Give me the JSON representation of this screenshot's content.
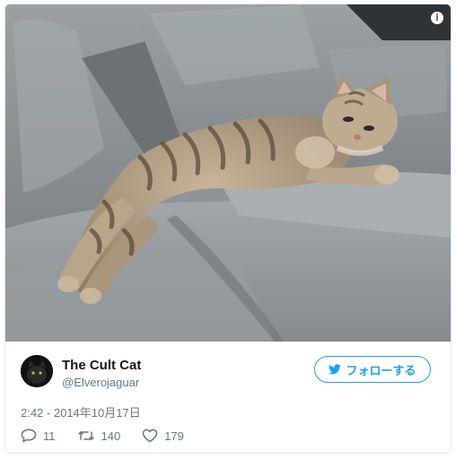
{
  "media": {
    "alt": ""
  },
  "info_icon": "i",
  "author": {
    "name": "The Cult Cat",
    "handle": "@Elverojaguar"
  },
  "follow_button": {
    "label": "フォローする",
    "icon": "twitter-bird-icon"
  },
  "timestamp": "2:42 - 2014年10月17日",
  "actions": {
    "reply_count": "11",
    "retweet_count": "140",
    "like_count": "179"
  },
  "colors": {
    "accent": "#1da1f2",
    "muted": "#657786",
    "text": "#14171a",
    "border": "#e1e8ed"
  }
}
